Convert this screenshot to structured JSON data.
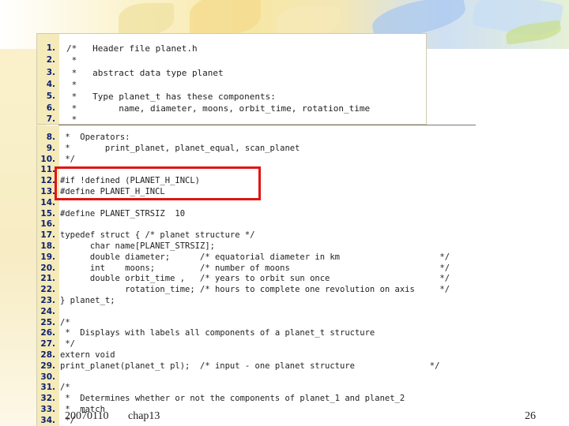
{
  "code_lines": [
    {
      "n": "1.",
      "t": "/*   Header file planet.h"
    },
    {
      "n": "2.",
      "t": " *"
    },
    {
      "n": "3.",
      "t": " *   abstract data type planet"
    },
    {
      "n": "4.",
      "t": " *"
    },
    {
      "n": "5.",
      "t": " *   Type planet_t has these components:"
    },
    {
      "n": "6.",
      "t": " *        name, diameter, moons, orbit_time, rotation_time"
    },
    {
      "n": "7.",
      "t": " *"
    },
    {
      "n": "8.",
      "t": " *  Operators:"
    },
    {
      "n": "9.",
      "t": " *       print_planet, planet_equal, scan_planet"
    },
    {
      "n": "10.",
      "t": " */"
    },
    {
      "n": "11.",
      "t": ""
    },
    {
      "n": "12.",
      "t": "#if !defined (PLANET_H_INCL)"
    },
    {
      "n": "13.",
      "t": "#define PLANET_H_INCL"
    },
    {
      "n": "14.",
      "t": ""
    },
    {
      "n": "15.",
      "t": "#define PLANET_STRSIZ  10"
    },
    {
      "n": "16.",
      "t": ""
    },
    {
      "n": "17.",
      "t": "typedef struct { /* planet structure */"
    },
    {
      "n": "18.",
      "t": "      char name[PLANET_STRSIZ];"
    },
    {
      "n": "19.",
      "t": "      double diameter;      /* equatorial diameter in km                    */"
    },
    {
      "n": "20.",
      "t": "      int    moons;         /* number of moons                              */"
    },
    {
      "n": "21.",
      "t": "      double orbit_time ,   /* years to orbit sun once                      */"
    },
    {
      "n": "22.",
      "t": "             rotation_time; /* hours to complete one revolution on axis     */"
    },
    {
      "n": "23.",
      "t": "} planet_t;"
    },
    {
      "n": "24.",
      "t": ""
    },
    {
      "n": "25.",
      "t": "/*"
    },
    {
      "n": "26.",
      "t": " *  Displays with labels all components of a planet_t structure"
    },
    {
      "n": "27.",
      "t": " */"
    },
    {
      "n": "28.",
      "t": "extern void"
    },
    {
      "n": "29.",
      "t": "print_planet(planet_t pl);  /* input - one planet structure               */"
    },
    {
      "n": "30.",
      "t": ""
    },
    {
      "n": "31.",
      "t": "/*"
    },
    {
      "n": "32.",
      "t": " *  Determines whether or not the components of planet_1 and planet_2"
    },
    {
      "n": "33.",
      "t": " *  match"
    },
    {
      "n": "34.",
      "t": " */"
    }
  ],
  "footer": {
    "date": "20070110",
    "title": "chap13",
    "page": "26"
  },
  "colors": {
    "highlight": "#e01515",
    "line_numbers": "#0c1f6e"
  }
}
